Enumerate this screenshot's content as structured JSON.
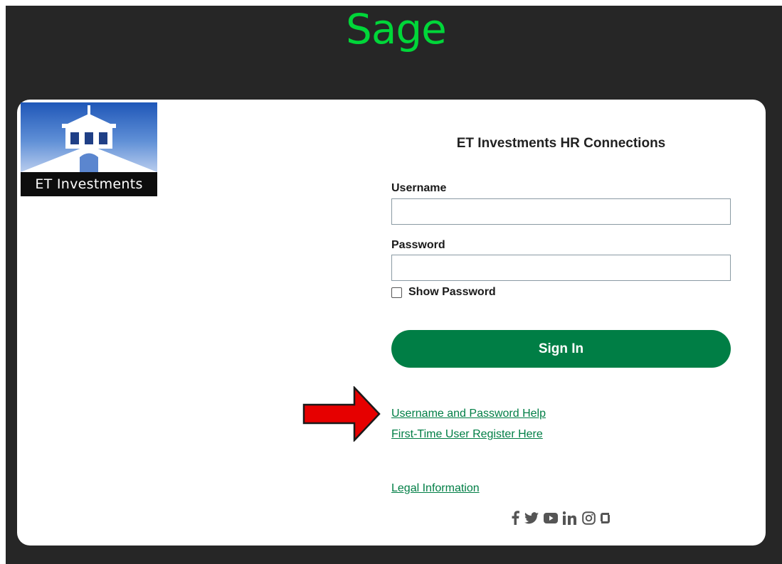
{
  "brand": {
    "name": "Sage",
    "color": "#00d639"
  },
  "company_logo": {
    "text": "ET Investments"
  },
  "page": {
    "title": "ET Investments HR Connections"
  },
  "form": {
    "username_label": "Username",
    "username_value": "",
    "password_label": "Password",
    "password_value": "",
    "show_password_label": "Show Password",
    "show_password_checked": false,
    "signin_label": "Sign In",
    "button_color": "#007e45"
  },
  "links": {
    "help": "Username and Password Help",
    "register": "First-Time User Register Here",
    "legal": "Legal Information"
  },
  "annotation": {
    "arrow_color": "#e60000",
    "points_to": "help"
  },
  "social_icons": [
    "facebook-icon",
    "twitter-icon",
    "youtube-icon",
    "linkedin-icon",
    "instagram-icon",
    "glassdoor-icon"
  ]
}
